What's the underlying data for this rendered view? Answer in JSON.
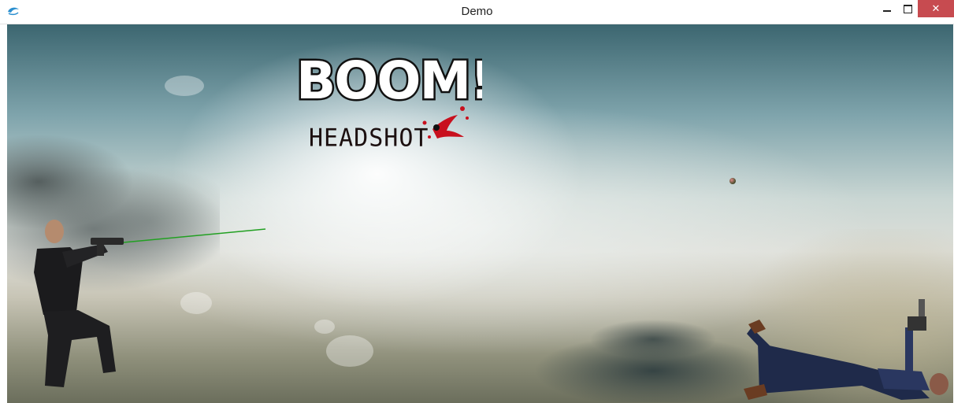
{
  "window": {
    "title": "Demo",
    "app_icon": "app-icon",
    "controls": {
      "minimize_icon": "minimize-icon",
      "maximize_icon": "maximize-icon",
      "close_icon": "close-icon",
      "close_glyph": "✕"
    }
  },
  "game": {
    "logo": {
      "word": "BOOM!",
      "subtitle": "HEADSHOT"
    },
    "colors": {
      "laser": "#22a022",
      "blood": "#c8101e",
      "close_button": "#c74b50"
    }
  }
}
